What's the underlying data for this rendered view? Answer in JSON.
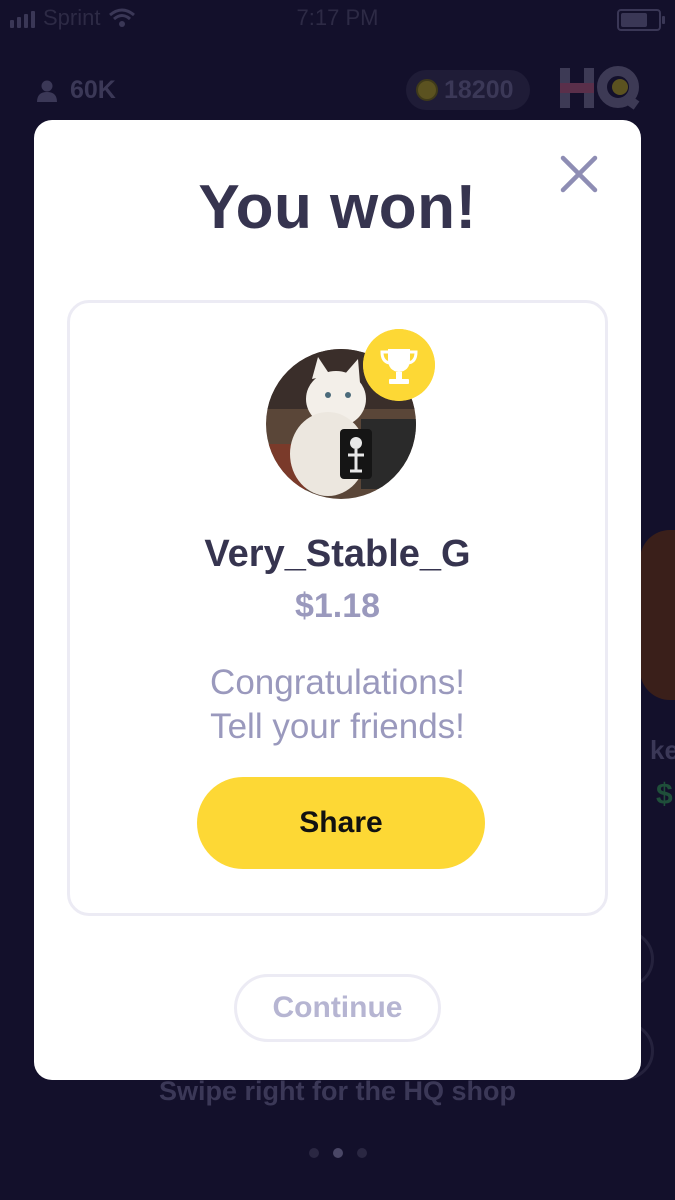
{
  "status_bar": {
    "carrier": "Sprint",
    "time": "7:17 PM"
  },
  "header": {
    "viewer_count": "60K",
    "coin_balance": "18200",
    "logo_text": "HQ"
  },
  "modal": {
    "title": "You won!",
    "winner": {
      "username": "Very_Stable_G",
      "amount": "$1.18"
    },
    "congrats_line1": "Congratulations!",
    "congrats_line2": "Tell your friends!",
    "share_label": "Share",
    "continue_label": "Continue"
  },
  "background": {
    "swipe_hint": "Swipe right for the HQ shop",
    "peek_text": "kes",
    "peek_amount": "$"
  },
  "colors": {
    "background": "#13102b",
    "accent_yellow": "#fdd835",
    "title_text": "#36344f",
    "muted_text": "#9a99bd"
  },
  "icons": {
    "close": "close-icon",
    "trophy": "trophy-icon",
    "user": "user-icon",
    "coin": "coin-icon"
  }
}
